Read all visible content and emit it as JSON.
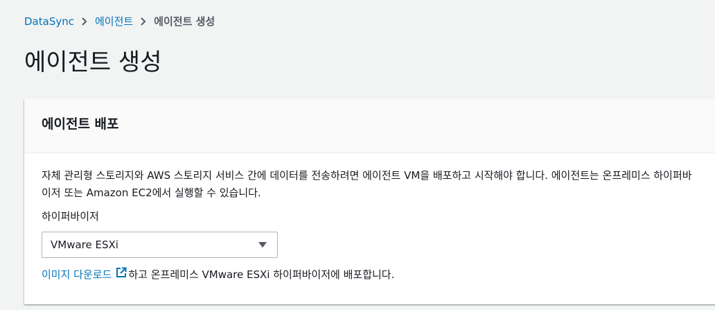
{
  "breadcrumb": {
    "items": [
      "DataSync",
      "에이전트"
    ],
    "current": "에이전트 생성"
  },
  "page": {
    "title": "에이전트 생성"
  },
  "panel": {
    "title": "에이전트 배포",
    "description": "자체 관리형 스토리지와 AWS 스토리지 서비스 간에 데이터를 전송하려면 에이전트 VM을 배포하고 시작해야 합니다. 에이전트는 온프레미스 하이퍼바이저 또는 Amazon EC2에서 실행할 수 있습니다.",
    "hypervisor_label": "하이퍼바이저",
    "hypervisor_selected": "VMware ESXi",
    "download_link": "이미지 다운로드",
    "download_suffix": "하고 온프레미스 VMware ESXi 하이퍼바이저에 배포합니다."
  },
  "colors": {
    "link": "#0073bb",
    "background": "#f2f3f3"
  },
  "icons": [
    "chevron-right-icon",
    "caret-down-icon",
    "external-link-icon"
  ]
}
